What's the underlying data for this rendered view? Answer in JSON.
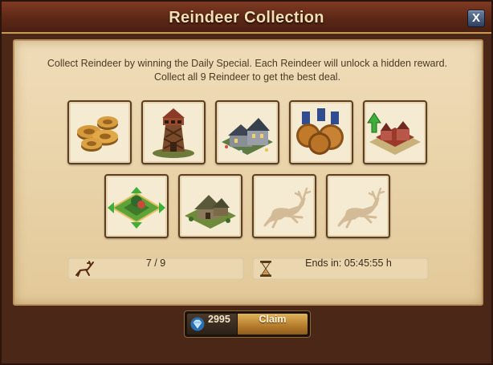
{
  "window": {
    "title": "Reindeer Collection",
    "close_label": "X"
  },
  "description": "Collect Reindeer by winning the Daily Special. Each Reindeer will unlock a hidden reward. Collect all 9 Reindeer to get the best deal.",
  "rewards": [
    {
      "name": "coins",
      "icon": "coins-icon",
      "unlocked": true
    },
    {
      "name": "watchtower",
      "icon": "watchtower-icon",
      "unlocked": true
    },
    {
      "name": "village-building",
      "icon": "village-building-icon",
      "unlocked": true
    },
    {
      "name": "medals",
      "icon": "medals-icon",
      "unlocked": true
    },
    {
      "name": "building-upgrade",
      "icon": "building-upgrade-icon",
      "unlocked": true
    },
    {
      "name": "expansion",
      "icon": "expansion-icon",
      "unlocked": true
    },
    {
      "name": "cottage",
      "icon": "cottage-icon",
      "unlocked": true
    },
    {
      "name": "locked-reward-1",
      "icon": "reindeer-silhouette-icon",
      "unlocked": false
    },
    {
      "name": "locked-reward-2",
      "icon": "reindeer-silhouette-icon",
      "unlocked": false
    }
  ],
  "progress": {
    "icon": "reindeer-icon",
    "text": "7 / 9"
  },
  "timer": {
    "icon": "hourglass-icon",
    "text": "Ends in: 05:45:55 h"
  },
  "claim": {
    "cost_icon": "diamond-icon",
    "cost": "2995",
    "label": "Claim"
  },
  "colors": {
    "title_text": "#f4dfb0",
    "panel_bg": "#efdcb8",
    "claim_gold": "#c58b35",
    "silhouette": "#d4bb97"
  }
}
